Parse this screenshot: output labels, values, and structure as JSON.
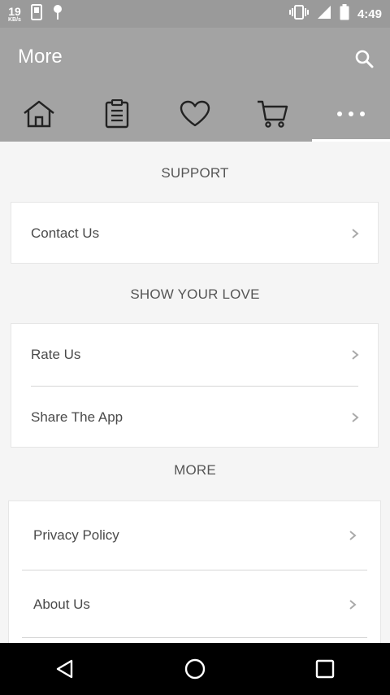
{
  "status_bar": {
    "speed_value": "19",
    "speed_unit": "KB/s",
    "time": "4:49"
  },
  "app_bar": {
    "title": "More",
    "tabs": [
      {
        "icon": "home-icon"
      },
      {
        "icon": "clipboard-icon"
      },
      {
        "icon": "heart-icon"
      },
      {
        "icon": "cart-icon"
      },
      {
        "icon": "more-dots-icon",
        "active": true
      }
    ]
  },
  "sections": {
    "support": {
      "header": "SUPPORT",
      "items": [
        "Contact Us"
      ]
    },
    "love": {
      "header": "SHOW YOUR LOVE",
      "items": [
        "Rate Us",
        "Share The App"
      ]
    },
    "more": {
      "header": "MORE",
      "items": [
        "Privacy Policy",
        "About Us"
      ]
    }
  },
  "colors": {
    "status_bar": "#9a9a9a",
    "app_bar": "#a3a3a3",
    "background": "#f5f5f5",
    "card": "#ffffff",
    "nav_bar": "#000000"
  }
}
